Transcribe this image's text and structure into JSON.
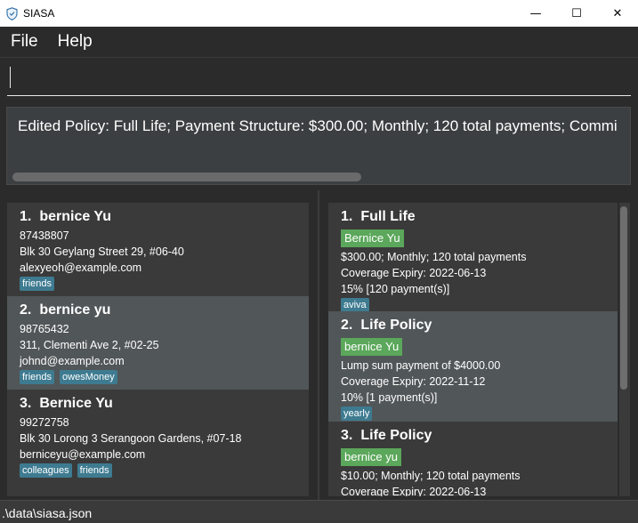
{
  "window": {
    "title": "SIASA",
    "controls": {
      "minimize": "—",
      "maximize": "☐",
      "close": "✕"
    }
  },
  "menu": {
    "file": "File",
    "help": "Help"
  },
  "command": {
    "value": ""
  },
  "result": {
    "text": "Edited Policy: Full Life; Payment Structure: $300.00; Monthly; 120 total payments; Commi"
  },
  "persons": [
    {
      "index": "1.",
      "name": "bernice Yu",
      "phone": "87438807",
      "address": "Blk 30 Geylang Street 29, #06-40",
      "email": "alexyeoh@example.com",
      "tags": [
        "friends"
      ]
    },
    {
      "index": "2.",
      "name": "bernice yu",
      "phone": "98765432",
      "address": "311, Clementi Ave 2, #02-25",
      "email": "johnd@example.com",
      "tags": [
        "friends",
        "owesMoney"
      ]
    },
    {
      "index": "3.",
      "name": "Bernice Yu",
      "phone": "99272758",
      "address": "Blk 30 Lorong 3 Serangoon Gardens, #07-18",
      "email": "berniceyu@example.com",
      "tags": [
        "colleagues",
        "friends"
      ]
    }
  ],
  "policies": [
    {
      "index": "1.",
      "name": "Full Life",
      "owner": "Bernice Yu",
      "payment": "$300.00; Monthly; 120 total payments",
      "expiry": "Coverage Expiry: 2022-06-13",
      "commission": "15% [120 payment(s)]",
      "tags": [
        "aviva"
      ]
    },
    {
      "index": "2.",
      "name": "Life Policy",
      "owner": "bernice Yu",
      "payment": "Lump sum payment of $4000.00",
      "expiry": "Coverage Expiry: 2022-11-12",
      "commission": "10% [1 payment(s)]",
      "tags": [
        "yearly"
      ]
    },
    {
      "index": "3.",
      "name": "Life Policy",
      "owner": "bernice yu",
      "payment": "$10.00; Monthly; 120 total payments",
      "expiry": "Coverage Expiry: 2022-06-13",
      "commission": "",
      "tags": []
    }
  ],
  "status": {
    "path": ".\\data\\siasa.json"
  },
  "colors": {
    "accent_tag": "#3e7b91",
    "owner_tag": "#5ba75b",
    "background": "#2b2b2b",
    "card_alt": "#515658"
  }
}
